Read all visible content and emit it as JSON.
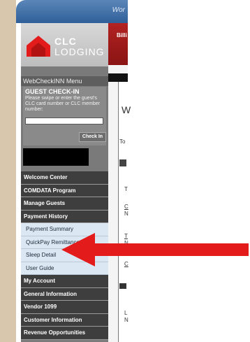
{
  "header": {
    "title_fragment": "Wor"
  },
  "logo": {
    "line1": "CLC",
    "line2": "LODGING"
  },
  "menu_title": "WebCheckINN Menu",
  "guest_checkin": {
    "title": "GUEST CHECK-IN",
    "instructions": "Please swipe or enter the guest's CLC card number or CLC member number:",
    "input_value": "",
    "button_label": "Check In"
  },
  "menu": {
    "items": [
      {
        "label": "Welcome Center"
      },
      {
        "label": "COMDATA Program"
      },
      {
        "label": "Manage Guests"
      },
      {
        "label": "Payment History"
      },
      {
        "label": "Payment Summary"
      },
      {
        "label": "QuickPay Remittance"
      },
      {
        "label": "Sleep Detail"
      },
      {
        "label": "User Guide"
      },
      {
        "label": "My Account"
      },
      {
        "label": "General Information"
      },
      {
        "label": "Vendor 1099"
      },
      {
        "label": "Customer Information"
      },
      {
        "label": "Revenue Opportunities"
      }
    ]
  },
  "right_panel": {
    "banner_text": "Billi",
    "heading_fragment": "W",
    "label_fragment": "To",
    "fragments": [
      "T",
      "C",
      "N",
      "T",
      "N",
      "C",
      "L",
      "N"
    ]
  },
  "colors": {
    "accent_red": "#e31b1b",
    "brand_red": "#b32222"
  }
}
